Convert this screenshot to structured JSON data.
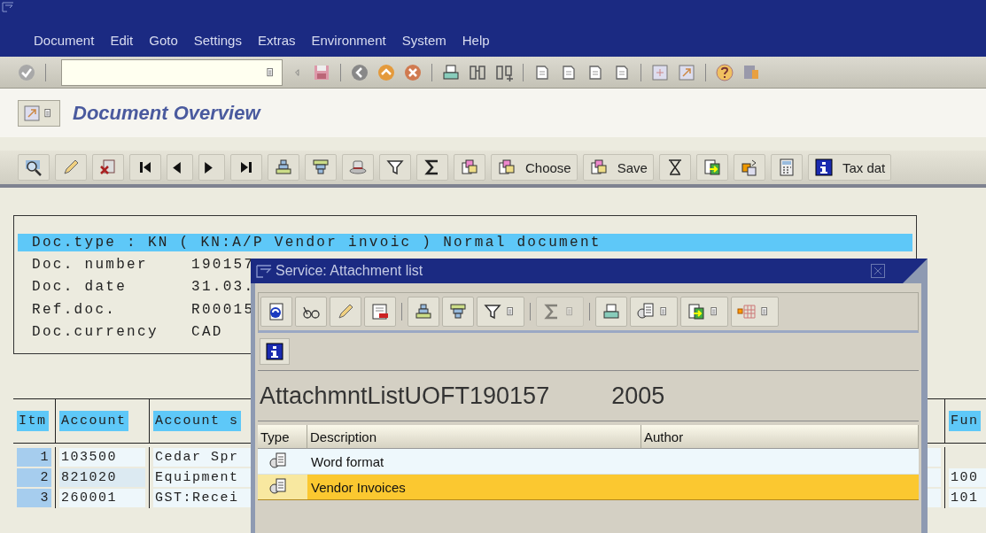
{
  "menu_bar": [
    "Document",
    "Edit",
    "Goto",
    "Settings",
    "Extras",
    "Environment",
    "System",
    "Help"
  ],
  "standard_toolbar": {
    "enter": {
      "kind": "enter"
    },
    "groups": [
      [
        {
          "kind": "triangle"
        },
        {
          "kind": "save"
        }
      ],
      [
        {
          "kind": "back"
        },
        {
          "kind": "exit"
        },
        {
          "kind": "cancel"
        }
      ],
      [
        {
          "kind": "print"
        },
        {
          "kind": "find"
        },
        {
          "kind": "find-next"
        }
      ],
      [
        {
          "kind": "page"
        },
        {
          "kind": "page"
        },
        {
          "kind": "page"
        },
        {
          "kind": "page"
        }
      ],
      [
        {
          "kind": "new-session"
        },
        {
          "kind": "shortcut"
        }
      ],
      [
        {
          "kind": "help"
        },
        {
          "kind": "layout"
        }
      ]
    ]
  },
  "title": "Document Overview",
  "app_toolbar": [
    {
      "kind": "display"
    },
    {
      "kind": "pencil"
    },
    {
      "kind": "delete"
    },
    {
      "kind": "first"
    },
    {
      "kind": "prev"
    },
    {
      "kind": "next"
    },
    {
      "kind": "last"
    },
    {
      "kind": "sort-up"
    },
    {
      "kind": "sort-down"
    },
    {
      "kind": "hat"
    },
    {
      "kind": "filter"
    },
    {
      "kind": "sum"
    },
    {
      "kind": "copy"
    },
    {
      "kind": "copy",
      "label": "Choose"
    },
    {
      "kind": "copy",
      "label": "Save"
    },
    {
      "kind": "hourglass"
    },
    {
      "kind": "export"
    },
    {
      "kind": "swap"
    },
    {
      "kind": "calculator"
    },
    {
      "kind": "info",
      "label": "Tax dat"
    }
  ],
  "header": {
    "doc_type_line": "Doc.type : KN ( KN:A/P Vendor invoic ) Normal document",
    "fields": [
      {
        "label": "Doc. number",
        "value": "190157"
      },
      {
        "label": "Doc. date",
        "value": "31.03."
      },
      {
        "label": "Ref.doc.",
        "value": "R00015"
      },
      {
        "label": "Doc.currency",
        "value": "CAD"
      }
    ]
  },
  "items_table": {
    "columns": [
      "Itm",
      "Account",
      "Account s",
      "Fun"
    ],
    "rows": [
      {
        "item": "1",
        "account": "103500",
        "column_3": "Cedar Spr"
      },
      {
        "item": "2",
        "account": "821020",
        "column_3": "Equipment",
        "column_4": "100"
      },
      {
        "item": "3",
        "account": "260001",
        "column_3": "GST:Recei",
        "column_4": "101"
      }
    ]
  },
  "dialog": {
    "title": "Service: Attachment list",
    "toolbar": [
      [
        {
          "kind": "refresh",
          "menu": false,
          "disabled": false
        },
        {
          "kind": "glasses",
          "menu": false,
          "disabled": false
        },
        {
          "kind": "pencil",
          "menu": false,
          "disabled": false
        },
        {
          "kind": "details",
          "menu": false,
          "disabled": false
        }
      ],
      [
        {
          "kind": "sort-up",
          "menu": false,
          "disabled": false
        },
        {
          "kind": "sort-down",
          "menu": false,
          "disabled": false
        },
        {
          "kind": "filter",
          "menu": true,
          "disabled": false
        }
      ],
      [
        {
          "kind": "sum",
          "menu": true,
          "disabled": true
        }
      ],
      [
        {
          "kind": "print",
          "menu": false,
          "disabled": false
        },
        {
          "kind": "word",
          "menu": true,
          "disabled": false
        },
        {
          "kind": "export",
          "menu": true,
          "disabled": false
        },
        {
          "kind": "grid",
          "menu": true,
          "disabled": false
        }
      ]
    ],
    "info_button": {
      "kind": "info"
    },
    "heading": "AttachmntListUOFT190157",
    "year": "2005",
    "columns": [
      "Type",
      "Description",
      "Author"
    ],
    "rows": [
      {
        "description": "Word format",
        "selected": false
      },
      {
        "description": "Vendor Invoices",
        "selected": true
      }
    ]
  }
}
